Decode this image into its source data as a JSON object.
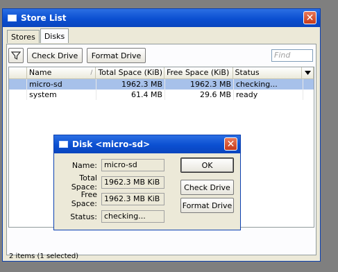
{
  "main_window": {
    "title": "Store List",
    "close_glyph": "✕",
    "tabs": [
      {
        "label": "Stores",
        "active": false
      },
      {
        "label": "Disks",
        "active": true
      }
    ],
    "toolbar": {
      "filter_icon": "filter-icon",
      "check_drive_label": "Check Drive",
      "format_drive_label": "Format Drive",
      "find_placeholder": "Find"
    },
    "table": {
      "columns": [
        "",
        "Name",
        "Total Space (KiB)",
        "Free Space (KiB)",
        "Status"
      ],
      "sort_indicator": "/",
      "rows": [
        {
          "name": "micro-sd",
          "total": "1962.3 MB",
          "free": "1962.3 MB",
          "status": "checking...",
          "selected": true
        },
        {
          "name": "system",
          "total": "61.4 MB",
          "free": "29.6 MB",
          "status": "ready",
          "selected": false
        }
      ]
    },
    "status_text": "2 items (1 selected)"
  },
  "dialog": {
    "title": "Disk <micro-sd>",
    "close_glyph": "✕",
    "fields": [
      {
        "label": "Name:",
        "value": "micro-sd"
      },
      {
        "label": "Total Space:",
        "value": "1962.3 MB KiB"
      },
      {
        "label": "Free Space:",
        "value": "1962.3 MB KiB"
      },
      {
        "label": "Status:",
        "value": "checking..."
      }
    ],
    "buttons": {
      "ok": "OK",
      "check_drive": "Check Drive",
      "format_drive": "Format Drive"
    }
  },
  "colors": {
    "titlebar": "#0b4fd1",
    "selection": "#a7c1ea",
    "desktop": "#7f7f7f"
  }
}
